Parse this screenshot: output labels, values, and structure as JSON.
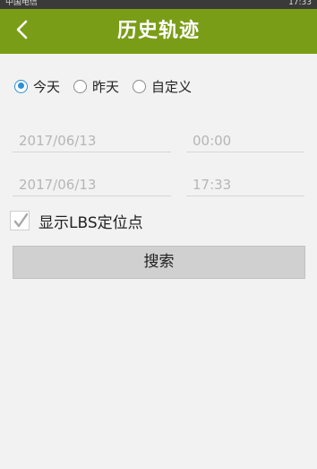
{
  "status_bar": {
    "carrier": "中国电信",
    "time": "17:33"
  },
  "header": {
    "title": "历史轨迹",
    "back_icon": "chevron-left-icon",
    "color": "#7a9d18"
  },
  "range_options": [
    {
      "label": "今天",
      "selected": true
    },
    {
      "label": "昨天",
      "selected": false
    },
    {
      "label": "自定义",
      "selected": false
    }
  ],
  "start": {
    "date": "2017/06/13",
    "time": "00:00"
  },
  "end": {
    "date": "2017/06/13",
    "time": "17:33"
  },
  "lbs_option": {
    "label": "显示LBS定位点",
    "checked": true
  },
  "search_button": {
    "label": "搜索"
  }
}
